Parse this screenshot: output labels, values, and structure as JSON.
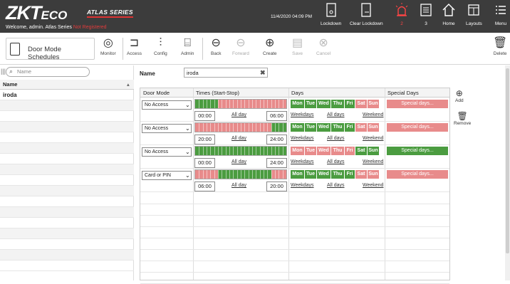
{
  "app": {
    "logo_main": "ZKT",
    "logo_sub": "ECO",
    "series": "ATLAS SERIES",
    "welcome": "Welcome, admin.  Atlas Series ",
    "not_registered": "Not Registered",
    "datetime": "11/4/2020 04:09 PM"
  },
  "topnav": {
    "lockdown": "Lockdown",
    "clear_lockdown": "Clear Lockdown",
    "alarm_count": "2",
    "events_count": "3",
    "home": "Home",
    "layouts": "Layouts",
    "menu": "Menu"
  },
  "toolbar": {
    "module_title": "Door Mode Schedules",
    "monitor": "Monitor",
    "access": "Access",
    "config": "Config",
    "admin": "Admin",
    "back": "Back",
    "forward": "Forward",
    "create": "Create",
    "save": "Save",
    "cancel": "Cancel",
    "delete": "Delete"
  },
  "list": {
    "search_placeholder": "Name",
    "column": "Name",
    "items": [
      "iroda"
    ]
  },
  "form": {
    "name_label": "Name",
    "name_value": "iroda"
  },
  "grid": {
    "headers": {
      "door_mode": "Door Mode",
      "times": "Times (Start-Stop)",
      "days": "Days",
      "special": "Special Days"
    },
    "day_labels": [
      "Mon",
      "Tue",
      "Wed",
      "Thu",
      "Fri",
      "Sat",
      "Sun"
    ],
    "all_day": "All day",
    "weekdays": "Weekdays",
    "all_days": "All days",
    "weekend": "Weekend",
    "special_button": "Special days...",
    "rows": [
      {
        "mode": "No Access",
        "start": "00:00",
        "stop": "06:00",
        "start_frac": 0.0,
        "stop_frac": 0.25,
        "days": [
          1,
          1,
          1,
          1,
          1,
          0,
          0
        ],
        "special_on": false
      },
      {
        "mode": "No Access",
        "start": "20:00",
        "stop": "24:00",
        "start_frac": 0.8333,
        "stop_frac": 1.0,
        "days": [
          1,
          1,
          1,
          1,
          1,
          0,
          0
        ],
        "special_on": false
      },
      {
        "mode": "No Access",
        "start": "00:00",
        "stop": "24:00",
        "start_frac": 0.0,
        "stop_frac": 1.0,
        "days": [
          0,
          0,
          0,
          0,
          0,
          1,
          1
        ],
        "special_on": true
      },
      {
        "mode": "Card or PIN",
        "start": "06:00",
        "stop": "20:00",
        "start_frac": 0.25,
        "stop_frac": 0.8333,
        "days": [
          1,
          1,
          1,
          1,
          1,
          0,
          0
        ],
        "special_on": false
      }
    ],
    "add": "Add",
    "remove": "Remove"
  },
  "colors": {
    "active": "#4b9c40",
    "inactive": "#e88b8b",
    "topbar": "#3c3c3c"
  }
}
